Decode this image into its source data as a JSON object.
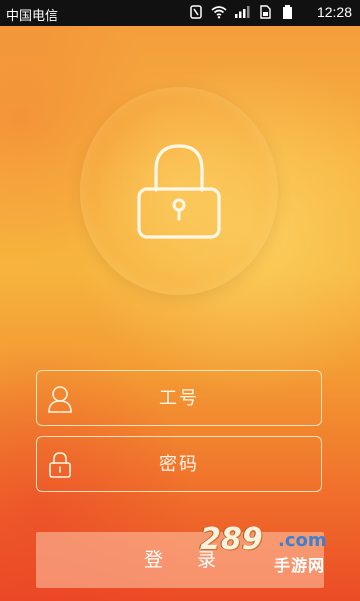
{
  "status_bar": {
    "carrier": "中国电信",
    "time": "12:28"
  },
  "login_form": {
    "username_placeholder": "工号",
    "password_placeholder": "密码",
    "login_label": "登 录"
  },
  "watermark": {
    "number": "289",
    "domain": ".com",
    "brand": "手游网"
  },
  "icons": {
    "status": [
      "nfc-icon",
      "wifi-icon",
      "signal-icon",
      "sim-icon",
      "battery-icon"
    ],
    "lock": "padlock-icon",
    "user": "user-icon",
    "password": "lock-icon"
  }
}
